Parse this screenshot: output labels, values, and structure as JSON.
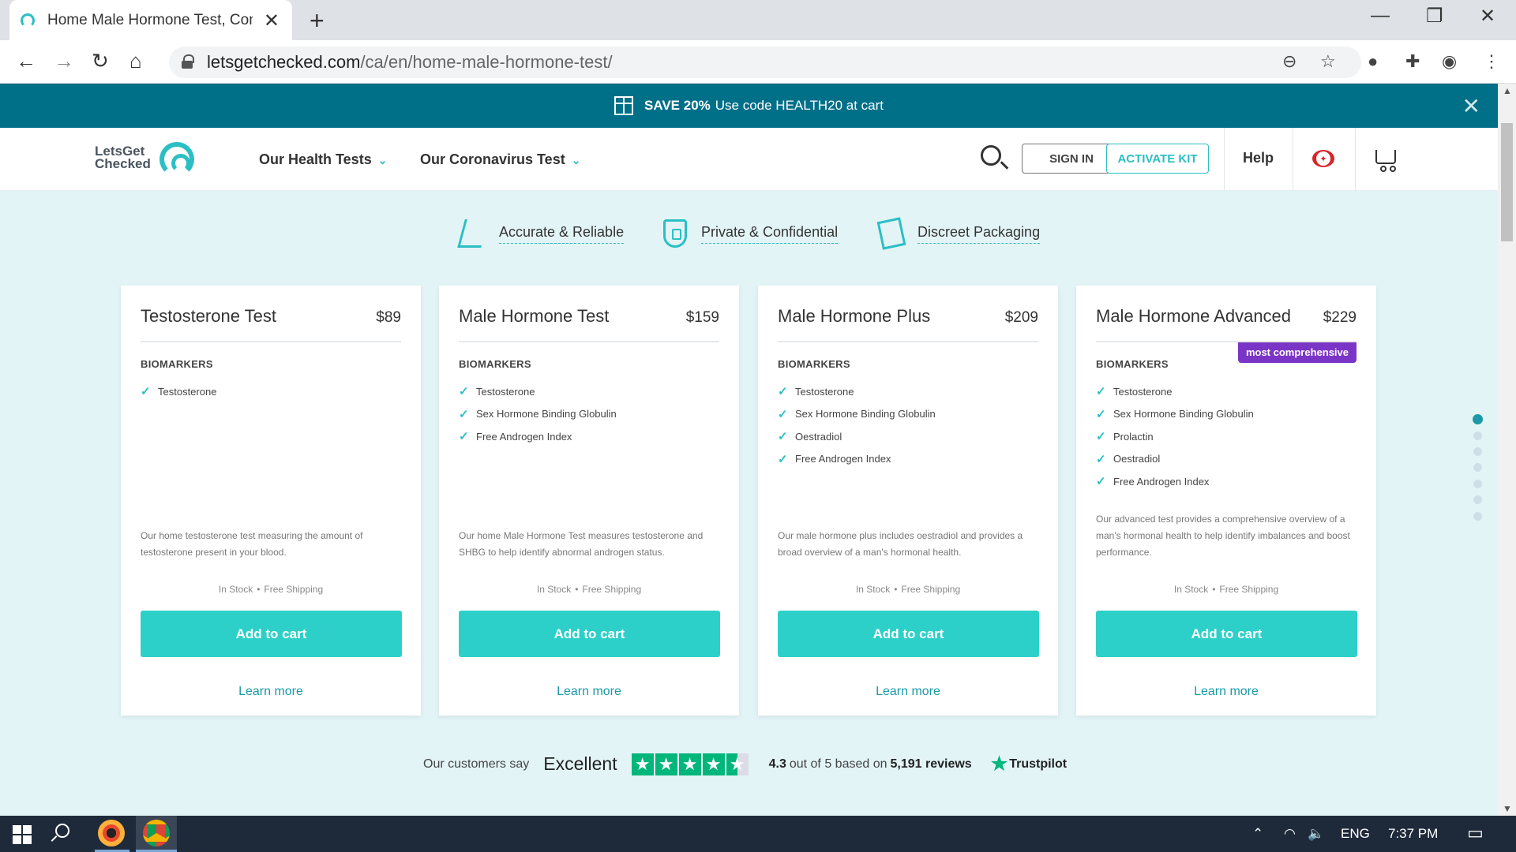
{
  "browser": {
    "tab_title": "Home Male Hormone Test, Confi",
    "url_host": "letsgetchecked.com",
    "url_path": "/ca/en/home-male-hormone-test/"
  },
  "promo": {
    "bold": "SAVE 20%",
    "text": "Use code HEALTH20 at cart"
  },
  "header": {
    "logo_line1": "LetsGet",
    "logo_line2": "Checked",
    "nav": [
      "Our Health Tests",
      "Our Coronavirus Test"
    ],
    "sign_in": "SIGN IN",
    "activate_kit": "ACTIVATE KIT",
    "help": "Help"
  },
  "features": [
    "Accurate & Reliable",
    "Private & Confidential",
    "Discreet Packaging"
  ],
  "products": [
    {
      "name": "Testosterone Test",
      "price": "$89",
      "biomarkers_label": "BIOMARKERS",
      "biomarkers": [
        "Testosterone"
      ],
      "description": "Our home testosterone test measuring the amount of testosterone present in your blood.",
      "stock": "In Stock",
      "shipping": "Free Shipping",
      "add_label": "Add to cart",
      "learn_label": "Learn more"
    },
    {
      "name": "Male Hormone Test",
      "price": "$159",
      "biomarkers_label": "BIOMARKERS",
      "biomarkers": [
        "Testosterone",
        "Sex Hormone Binding Globulin",
        "Free Androgen Index"
      ],
      "description": "Our home Male Hormone Test measures testosterone and SHBG to help identify abnormal androgen status.",
      "stock": "In Stock",
      "shipping": "Free Shipping",
      "add_label": "Add to cart",
      "learn_label": "Learn more"
    },
    {
      "name": "Male Hormone Plus",
      "price": "$209",
      "biomarkers_label": "BIOMARKERS",
      "biomarkers": [
        "Testosterone",
        "Sex Hormone Binding Globulin",
        "Oestradiol",
        "Free Androgen Index"
      ],
      "description": "Our male hormone plus includes oestradiol and provides a broad overview of a man's hormonal health.",
      "stock": "In Stock",
      "shipping": "Free Shipping",
      "add_label": "Add to cart",
      "learn_label": "Learn more"
    },
    {
      "name": "Male Hormone Advanced",
      "price": "$229",
      "badge": "most comprehensive",
      "biomarkers_label": "BIOMARKERS",
      "biomarkers": [
        "Testosterone",
        "Sex Hormone Binding Globulin",
        "Prolactin",
        "Oestradiol",
        "Free Androgen Index"
      ],
      "description": "Our advanced test provides a comprehensive overview of a man's hormonal health to help identify imbalances and boost performance.",
      "stock": "In Stock",
      "shipping": "Free Shipping",
      "add_label": "Add to cart",
      "learn_label": "Learn more"
    }
  ],
  "trustpilot": {
    "lead": "Our customers say",
    "rating_word": "Excellent",
    "score": "4.3",
    "out_of": "out of 5 based on",
    "reviews": "5,191 reviews",
    "brand": "Trustpilot"
  },
  "taskbar": {
    "lang": "ENG",
    "time": "7:37 PM"
  },
  "colors": {
    "promo_bg": "#006f88",
    "accent": "#2bbfc4",
    "cta": "#2dd0c8",
    "badge": "#7b35c6",
    "page_bg": "#e3f4f7"
  }
}
